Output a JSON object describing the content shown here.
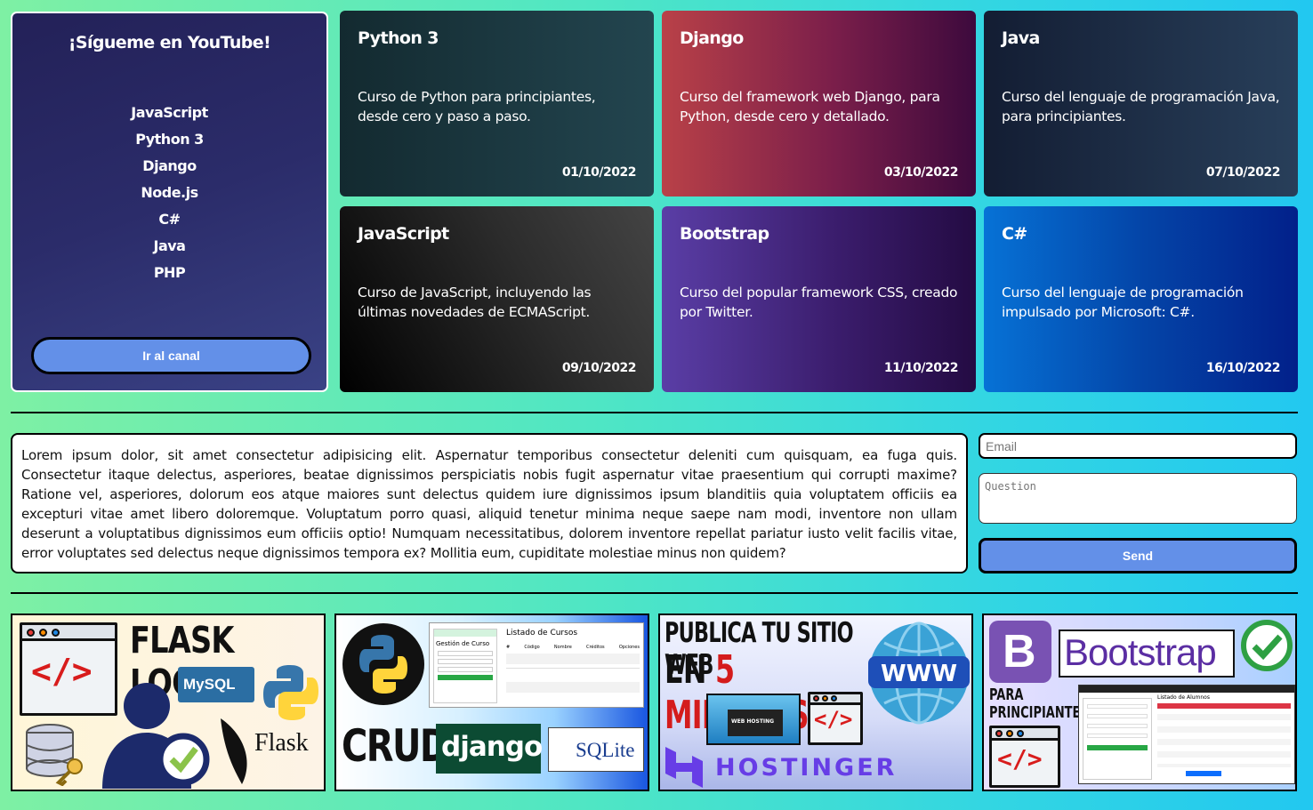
{
  "sidebar": {
    "title": "¡Sígueme en YouTube!",
    "items": [
      "JavaScript",
      "Python 3",
      "Django",
      "Node.js",
      "C#",
      "Java",
      "PHP"
    ],
    "button_label": "Ir al canal"
  },
  "cards": [
    {
      "title": "Python 3",
      "description": "Curso de Python para principiantes, desde cero y paso a paso.",
      "date": "01/10/2022"
    },
    {
      "title": "Django",
      "description": "Curso del framework web Django, para Python, desde cero y detallado.",
      "date": "03/10/2022"
    },
    {
      "title": "Java",
      "description": "Curso del lenguaje de programación Java, para principiantes.",
      "date": "07/10/2022"
    },
    {
      "title": "JavaScript",
      "description": "Curso de JavaScript, incluyendo las últimas novedades de ECMAScript.",
      "date": "09/10/2022"
    },
    {
      "title": "Bootstrap",
      "description": "Curso del popular framework CSS, creado por Twitter.",
      "date": "11/10/2022"
    },
    {
      "title": "C#",
      "description": "Curso del lenguaje de programación impulsado por Microsoft: C#.",
      "date": "16/10/2022"
    }
  ],
  "lorem": "Lorem ipsum dolor, sit amet consectetur adipisicing elit. Aspernatur temporibus consectetur deleniti cum quisquam, ea fuga quis. Consectetur itaque delectus, asperiores, beatae dignissimos perspiciatis nobis fugit aspernatur vitae praesentium qui corrupti maxime? Ratione vel, asperiores, dolorum eos atque maiores sunt delectus quidem iure dignissimos ipsum blanditiis quia voluptatem officiis ea excepturi vitae amet libero doloremque. Voluptatum porro quasi, aliquid tenetur minima neque saepe nam modi, inventore non ullam deserunt a voluptatibus dignissimos eum officiis optio! Numquam necessitatibus, dolorem inventore repellat pariatur iusto velit facilis vitae, error voluptates sed delectus neque dignissimos tempora ex? Mollitia eum, cupiditate molestiae minus non quidem?",
  "form": {
    "email_placeholder": "Email",
    "question_placeholder": "Question",
    "send_label": "Send"
  },
  "thumbnails": {
    "flask": {
      "title": "FLASK LOGIN",
      "mysql": "MySQL",
      "flask_word": "Flask"
    },
    "crud": {
      "crud_word": "CRUD",
      "django_word": "django",
      "sqlite_word": "SQLite",
      "list_title": "Listado de Cursos",
      "form_title": "Gestión de Curso",
      "columns": [
        "#",
        "Código",
        "Nombre",
        "Créditos",
        "Opciones"
      ]
    },
    "hosting": {
      "line1": "PUBLICA TU SITIO WEB",
      "line2_a": "EN ",
      "line2_b": "5 MINUTOS",
      "www": "WWW",
      "brand": "HOSTINGER",
      "badge": "WEB HOSTING"
    },
    "bootstrap": {
      "letter": "B",
      "word": "Bootstrap",
      "para": "PARA",
      "principiantes": "PRINCIPIANTES",
      "mock_title": "Listado de Alumnos"
    }
  },
  "colors": {
    "accent": "#6390e8",
    "sidebar_bg": "#2b2c6a",
    "page_bg_start": "#7ef0a4",
    "page_bg_end": "#22c8f0"
  }
}
